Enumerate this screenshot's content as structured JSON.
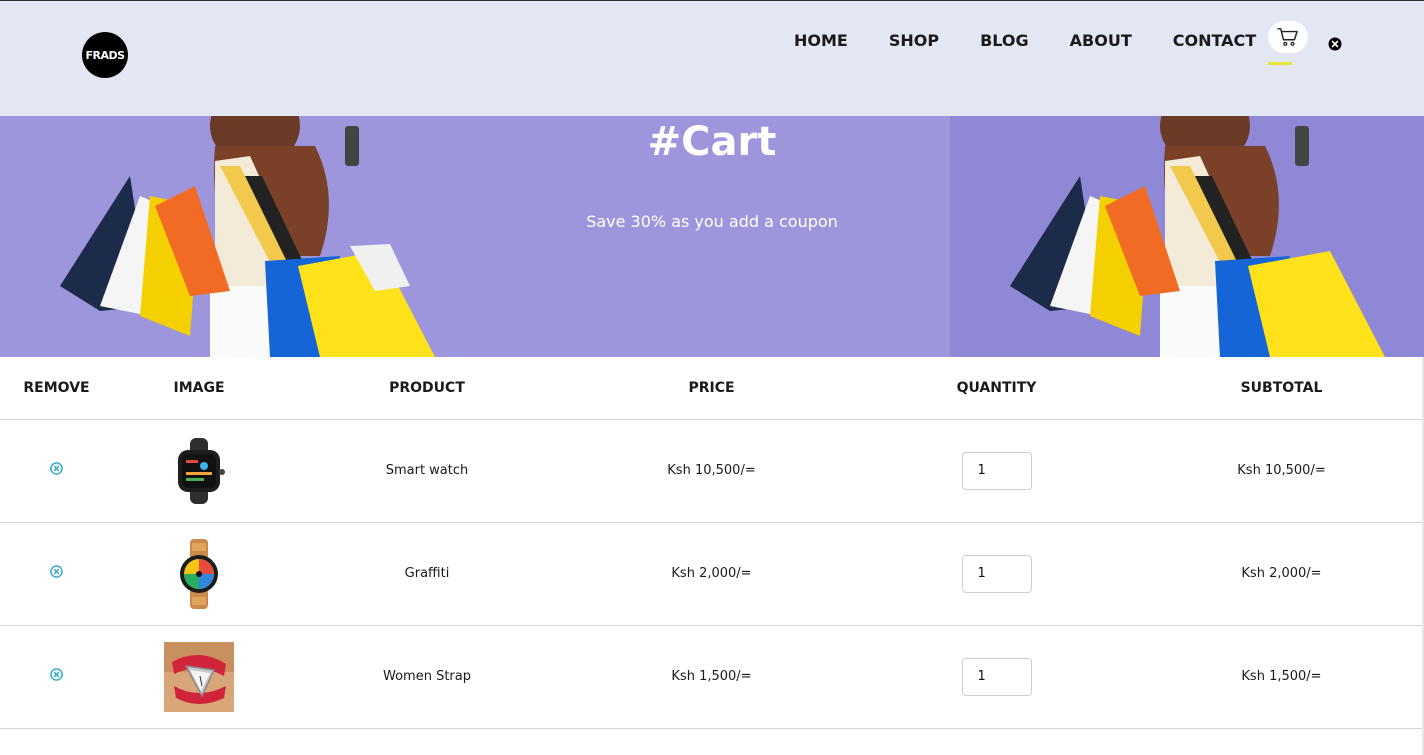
{
  "brand": {
    "logo_text": "FRADS"
  },
  "nav": {
    "items": [
      "HOME",
      "SHOP",
      "BLOG",
      "ABOUT",
      "CONTACT"
    ]
  },
  "hero": {
    "title": "#Cart",
    "subtitle": "Save 30% as you add a coupon"
  },
  "table": {
    "headers": [
      "REMOVE",
      "IMAGE",
      "PRODUCT",
      "PRICE",
      "QUANTITY",
      "SUBTOTAL"
    ],
    "rows": [
      {
        "product": "Smart watch",
        "price": "Ksh 10,500/=",
        "quantity": "1",
        "subtotal": "Ksh 10,500/="
      },
      {
        "product": "Graffiti",
        "price": "Ksh 2,000/=",
        "quantity": "1",
        "subtotal": "Ksh 2,000/="
      },
      {
        "product": "Women Strap",
        "price": "Ksh 1,500/=",
        "quantity": "1",
        "subtotal": "Ksh 1,500/="
      }
    ]
  },
  "colors": {
    "header_bg": "#e3e6f3",
    "hero_bg": "#9d96dd",
    "accent_underline": "#e3e633",
    "remove_icon": "#2aa6c9"
  },
  "icons": {
    "cart": "cart-icon",
    "close": "close-circle-icon",
    "remove": "remove-circle-icon"
  }
}
